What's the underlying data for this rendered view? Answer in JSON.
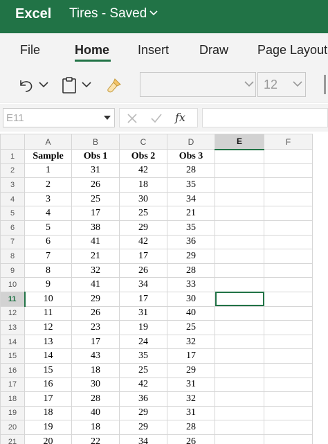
{
  "app": {
    "name": "Excel",
    "doc_title": "Tires",
    "status": "Saved"
  },
  "tabs": [
    "File",
    "Home",
    "Insert",
    "Draw",
    "Page Layout"
  ],
  "active_tab": "Home",
  "toolbar": {
    "font_name": "",
    "font_size": "12"
  },
  "formula_bar": {
    "name_box": "E11",
    "formula": "",
    "fx_label": "fx"
  },
  "colors": {
    "accent": "#217346"
  },
  "sheet": {
    "columns": [
      "A",
      "B",
      "C",
      "D",
      "E",
      "F"
    ],
    "selected_column": "E",
    "selected_row": 11,
    "row_count": 22,
    "headers": [
      "Sample",
      "Obs 1",
      "Obs 2",
      "Obs 3"
    ],
    "rows": [
      [
        "1",
        "31",
        "42",
        "28"
      ],
      [
        "2",
        "26",
        "18",
        "35"
      ],
      [
        "3",
        "25",
        "30",
        "34"
      ],
      [
        "4",
        "17",
        "25",
        "21"
      ],
      [
        "5",
        "38",
        "29",
        "35"
      ],
      [
        "6",
        "41",
        "42",
        "36"
      ],
      [
        "7",
        "21",
        "17",
        "29"
      ],
      [
        "8",
        "32",
        "26",
        "28"
      ],
      [
        "9",
        "41",
        "34",
        "33"
      ],
      [
        "10",
        "29",
        "17",
        "30"
      ],
      [
        "11",
        "26",
        "31",
        "40"
      ],
      [
        "12",
        "23",
        "19",
        "25"
      ],
      [
        "13",
        "17",
        "24",
        "32"
      ],
      [
        "14",
        "43",
        "35",
        "17"
      ],
      [
        "15",
        "18",
        "25",
        "29"
      ],
      [
        "16",
        "30",
        "42",
        "31"
      ],
      [
        "17",
        "28",
        "36",
        "32"
      ],
      [
        "18",
        "40",
        "29",
        "31"
      ],
      [
        "19",
        "18",
        "29",
        "28"
      ],
      [
        "20",
        "22",
        "34",
        "26"
      ]
    ]
  }
}
